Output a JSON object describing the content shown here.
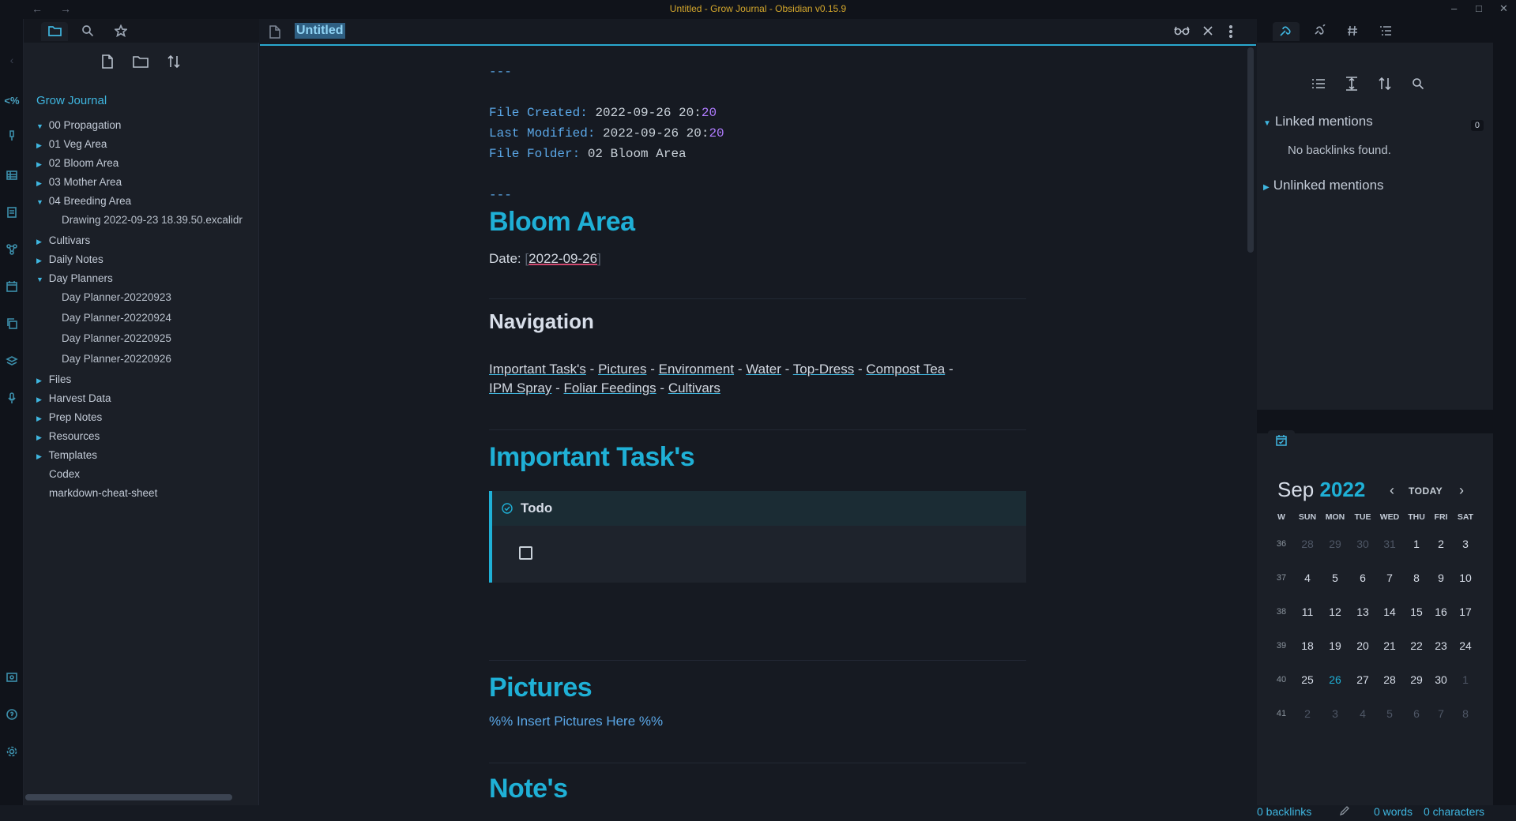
{
  "window": {
    "title": "Untitled - Grow Journal - Obsidian v0.15.9",
    "back": "←",
    "forward": "→",
    "minimize": "–",
    "maximize": "□",
    "close": "✕"
  },
  "ribbon": {
    "icons": [
      "code-icon",
      "brush-icon",
      "table-icon",
      "note-icon",
      "graph-icon",
      "calendar-icon",
      "copy-icon",
      "layers-icon",
      "mic-icon",
      "vault-icon",
      "help-icon",
      "settings-icon"
    ],
    "code_glyph": "<%"
  },
  "left_sidebar": {
    "tabs": [
      "file-explorer",
      "search",
      "bookmarks"
    ],
    "actions": [
      "new-note",
      "new-folder",
      "change-sort-order"
    ],
    "vault_name": "Grow Journal",
    "items": [
      {
        "label": "00 Propagation",
        "type": "folder",
        "expanded": true
      },
      {
        "label": "01 Veg Area",
        "type": "folder",
        "expanded": false
      },
      {
        "label": "02 Bloom Area",
        "type": "folder",
        "expanded": false
      },
      {
        "label": "03 Mother Area",
        "type": "folder",
        "expanded": false
      },
      {
        "label": "04 Breeding Area",
        "type": "folder",
        "expanded": true
      },
      {
        "label": "Drawing 2022-09-23 18.39.50.excalidr",
        "type": "file"
      },
      {
        "label": "Cultivars",
        "type": "folder",
        "expanded": false
      },
      {
        "label": "Daily Notes",
        "type": "folder",
        "expanded": false
      },
      {
        "label": "Day Planners",
        "type": "folder",
        "expanded": true
      },
      {
        "label": "Day Planner-20220923",
        "type": "file"
      },
      {
        "label": "Day Planner-20220924",
        "type": "file"
      },
      {
        "label": "Day Planner-20220925",
        "type": "file"
      },
      {
        "label": "Day Planner-20220926",
        "type": "file"
      },
      {
        "label": "Files",
        "type": "folder",
        "expanded": false
      },
      {
        "label": "Harvest Data",
        "type": "folder",
        "expanded": false
      },
      {
        "label": "Prep Notes",
        "type": "folder",
        "expanded": false
      },
      {
        "label": "Resources",
        "type": "folder",
        "expanded": false
      },
      {
        "label": "Templates",
        "type": "folder",
        "expanded": false
      },
      {
        "label": "Codex",
        "type": "file-root"
      },
      {
        "label": "markdown-cheat-sheet",
        "type": "file-root"
      }
    ]
  },
  "editor": {
    "tab_title": "Untitled",
    "header_icons": [
      "reading-view-icon",
      "close-icon",
      "more-options-icon"
    ],
    "frontmatter_dash": "---",
    "file_created_key": "File Created:",
    "file_created_val": "2022-09-26 20:",
    "file_created_min": "20",
    "last_modified_key": "Last Modified:",
    "last_modified_val": "2022-09-26 20:",
    "last_modified_min": "20",
    "file_folder_key": "File Folder:",
    "file_folder_val": "02 Bloom Area",
    "h1_bloom": "Bloom Area",
    "date_label": "Date:",
    "date_value": "2022-09-26",
    "h2_navigation": "Navigation",
    "nav_links": [
      "Important Task's",
      "Pictures",
      "Environment",
      "Water",
      "Top-Dress",
      "Compost Tea",
      "IPM Spray",
      "Foliar Feedings",
      "Cultivars"
    ],
    "nav_sep": "-",
    "h1_tasks": "Important Task's",
    "callout_title": "Todo",
    "h1_pictures": "Pictures",
    "pictures_comment": "%% Insert Pictures Here %%",
    "h1_notes": "Note's"
  },
  "right_sidebar": {
    "tabs": [
      "backlinks",
      "outgoing-links",
      "tags",
      "outline"
    ],
    "actions": [
      "collapse-results",
      "show-more-context",
      "change-sort-order",
      "search"
    ],
    "linked_mentions": "Linked mentions",
    "linked_count": "0",
    "no_backlinks": "No backlinks found.",
    "unlinked_mentions": "Unlinked mentions",
    "calendar": {
      "month": "Sep",
      "year": "2022",
      "today_label": "TODAY",
      "prev": "‹",
      "next": "›",
      "headers": [
        "W",
        "SUN",
        "MON",
        "TUE",
        "WED",
        "THU",
        "FRI",
        "SAT"
      ],
      "weeks": [
        {
          "w": "36",
          "days": [
            [
              "28",
              true
            ],
            [
              "29",
              true
            ],
            [
              "30",
              true
            ],
            [
              "31",
              true
            ],
            [
              "1",
              false
            ],
            [
              "2",
              false
            ],
            [
              "3",
              false
            ]
          ]
        },
        {
          "w": "37",
          "days": [
            [
              "4",
              false
            ],
            [
              "5",
              false
            ],
            [
              "6",
              false
            ],
            [
              "7",
              false
            ],
            [
              "8",
              false
            ],
            [
              "9",
              false
            ],
            [
              "10",
              false
            ]
          ]
        },
        {
          "w": "38",
          "days": [
            [
              "11",
              false
            ],
            [
              "12",
              false
            ],
            [
              "13",
              false
            ],
            [
              "14",
              false
            ],
            [
              "15",
              false
            ],
            [
              "16",
              false
            ],
            [
              "17",
              false
            ]
          ]
        },
        {
          "w": "39",
          "days": [
            [
              "18",
              false
            ],
            [
              "19",
              false
            ],
            [
              "20",
              false
            ],
            [
              "21",
              false
            ],
            [
              "22",
              false
            ],
            [
              "23",
              false
            ],
            [
              "24",
              false
            ]
          ]
        },
        {
          "w": "40",
          "days": [
            [
              "25",
              false
            ],
            [
              "26",
              false
            ],
            [
              "27",
              false
            ],
            [
              "28",
              false
            ],
            [
              "29",
              false
            ],
            [
              "30",
              false
            ],
            [
              "1",
              true
            ]
          ]
        },
        {
          "w": "41",
          "days": [
            [
              "2",
              true
            ],
            [
              "3",
              true
            ],
            [
              "4",
              true
            ],
            [
              "5",
              true
            ],
            [
              "6",
              true
            ],
            [
              "7",
              true
            ],
            [
              "8",
              true
            ]
          ]
        }
      ],
      "today_day": "26"
    }
  },
  "status_bar": {
    "backlinks": "0 backlinks",
    "words": "0 words",
    "characters": "0 characters"
  }
}
